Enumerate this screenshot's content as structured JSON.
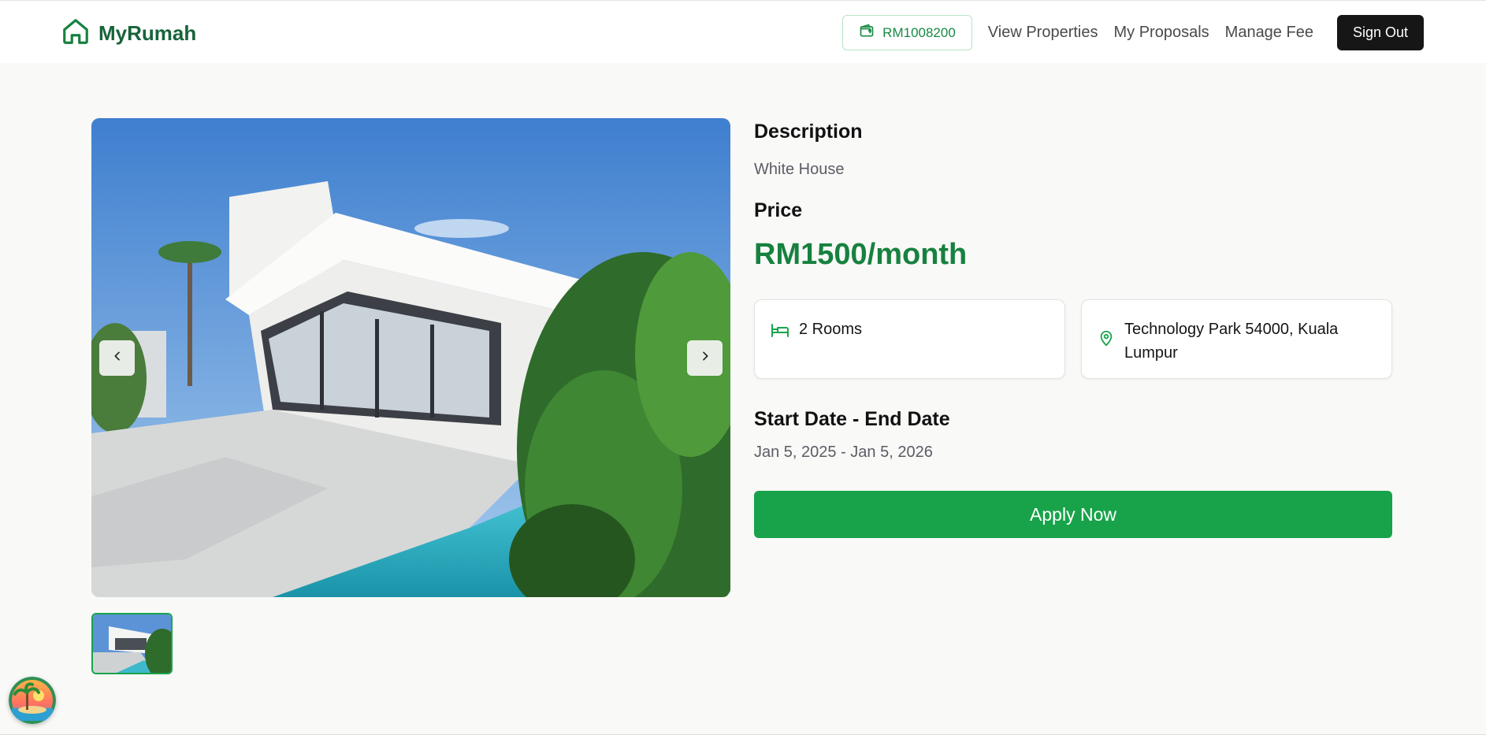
{
  "brand": {
    "name": "MyRumah",
    "icon": "house-icon"
  },
  "nav": {
    "wallet_balance": "RM1008200",
    "links": [
      "View Properties",
      "My Proposals",
      "Manage Fee"
    ],
    "signout_label": "Sign Out"
  },
  "gallery": {
    "prev_icon": "chevron-left-icon",
    "next_icon": "chevron-right-icon"
  },
  "details": {
    "description_heading": "Description",
    "description": "White House",
    "price_heading": "Price",
    "price": "RM1500/month",
    "rooms": "2 Rooms",
    "location": "Technology Park 54000, Kuala Lumpur",
    "dates_heading": "Start Date - End Date",
    "dates": "Jan 5, 2025 - Jan 5, 2026",
    "apply_label": "Apply Now"
  },
  "colors": {
    "brand_green": "#17643a",
    "accent_green": "#18a34a",
    "price_green": "#17813f",
    "dark": "#161616"
  }
}
